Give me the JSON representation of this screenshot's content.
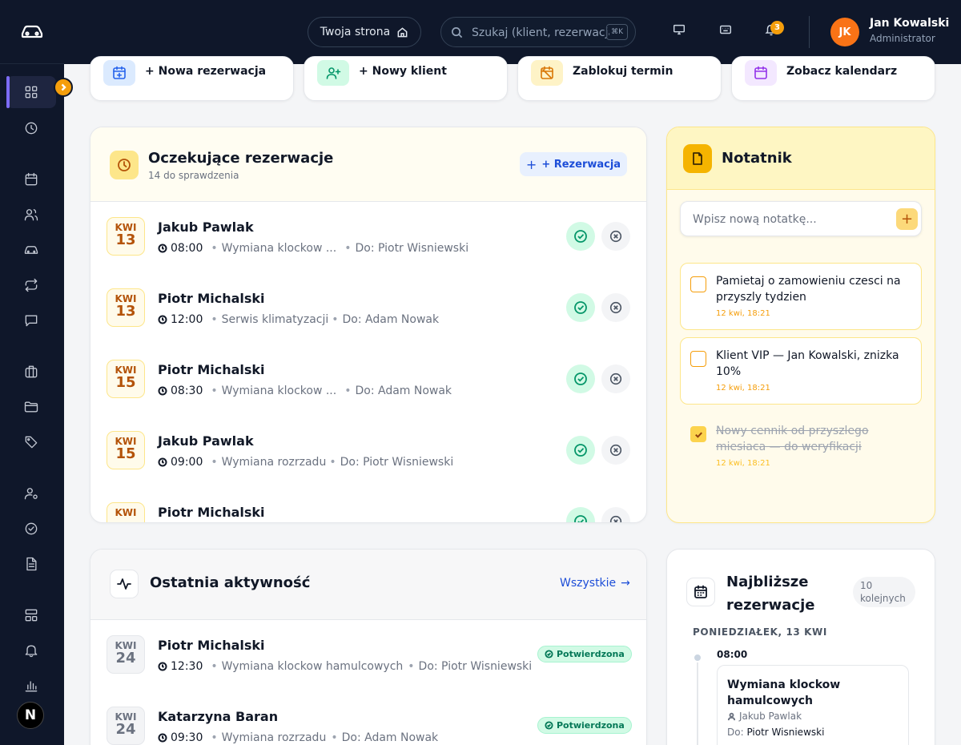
{
  "header": {
    "site_link": "Twoja strona",
    "search_placeholder": "Szukaj (klient, rezerwacja...)",
    "search_shortcut": "⌘K",
    "notification_count": "3",
    "user": {
      "initials": "JK",
      "name": "Jan Kowalski",
      "role": "Administrator"
    }
  },
  "sidebar": {
    "items": [
      "dashboard",
      "history",
      "calendar",
      "clients",
      "vehicles",
      "repeat",
      "messages",
      "services",
      "documents",
      "tags",
      "staff-settings",
      "tasks",
      "reports",
      "layout",
      "notifications",
      "statistics"
    ],
    "footer_initial": "N"
  },
  "quick_actions": [
    {
      "label": "+ Nowa rezerwacja",
      "icon": "calendar-plus-icon",
      "color": "#dbeafe"
    },
    {
      "label": "+ Nowy klient",
      "icon": "user-plus-icon",
      "color": "#d1fae5"
    },
    {
      "label": "Zablokuj termin",
      "icon": "calendar-block-icon",
      "color": "#fef3c7"
    },
    {
      "label": "Zobacz kalendarz",
      "icon": "calendar-icon",
      "color": "#f3e8ff"
    }
  ],
  "pending": {
    "title": "Oczekujące rezerwacje",
    "subtitle": "14 do sprawdzenia",
    "add_button": "+ Rezerwacja",
    "rows": [
      {
        "month": "KWI",
        "day": "13",
        "name": "Jakub Pawlak",
        "time": "08:00",
        "service": "Wymiana klockow ...",
        "staff": "Do: Piotr Wisniewski"
      },
      {
        "month": "KWI",
        "day": "13",
        "name": "Piotr Michalski",
        "time": "12:00",
        "service": "Serwis klimatyzacji",
        "staff": "Do: Adam Nowak"
      },
      {
        "month": "KWI",
        "day": "15",
        "name": "Piotr Michalski",
        "time": "08:30",
        "service": "Wymiana klockow ...",
        "staff": "Do: Adam Nowak"
      },
      {
        "month": "KWI",
        "day": "15",
        "name": "Jakub Pawlak",
        "time": "09:00",
        "service": "Wymiana rozrzadu",
        "staff": "Do: Piotr Wisniewski"
      },
      {
        "month": "KWI",
        "day": "",
        "name": "Piotr Michalski",
        "time": "",
        "service": "",
        "staff": ""
      }
    ]
  },
  "notes": {
    "title": "Notatnik",
    "input_placeholder": "Wpisz nową notatkę...",
    "add_symbol": "+",
    "items": [
      {
        "text": "Pamietaj o zamowieniu czesci na przyszly tydzien",
        "time": "12 kwi, 18:21",
        "done": false
      },
      {
        "text": "Klient VIP — Jan Kowalski, znizka 10%",
        "time": "12 kwi, 18:21",
        "done": false
      },
      {
        "text": "Nowy cennik od przyszlego miesiaca — do weryfikacji",
        "time": "12 kwi, 18:21",
        "done": true
      }
    ]
  },
  "activity": {
    "title": "Ostatnia aktywność",
    "link": "Wszystkie",
    "rows": [
      {
        "month": "KWI",
        "day": "24",
        "name": "Piotr Michalski",
        "time": "12:30",
        "service": "Wymiana klockow hamulcowych",
        "staff": "Do: Piotr Wisniewski",
        "status": "Potwierdzona"
      },
      {
        "month": "KWI",
        "day": "24",
        "name": "Katarzyna Baran",
        "time": "09:30",
        "service": "Wymiana rozrzadu",
        "staff": "Do: Adam Nowak",
        "status": "Potwierdzona"
      }
    ]
  },
  "upcoming": {
    "title_line1": "Najbliższe",
    "title_line2": "rezerwacje",
    "count_line1": "10",
    "count_line2": "kolejnych",
    "day_label": "PONIEDZIAŁEK, 13 KWI",
    "entry": {
      "time": "08:00",
      "title": "Wymiana klockow hamulcowych",
      "client": "Jakub Pawlak",
      "staff_prefix": "Do:",
      "staff": "Piotr Wisniewski"
    }
  },
  "colors": {
    "sidebar": "#0f172a",
    "accent": "#f59e0b",
    "active": "#7c6cf5",
    "success": "#059669",
    "link": "#1d4ed8"
  }
}
